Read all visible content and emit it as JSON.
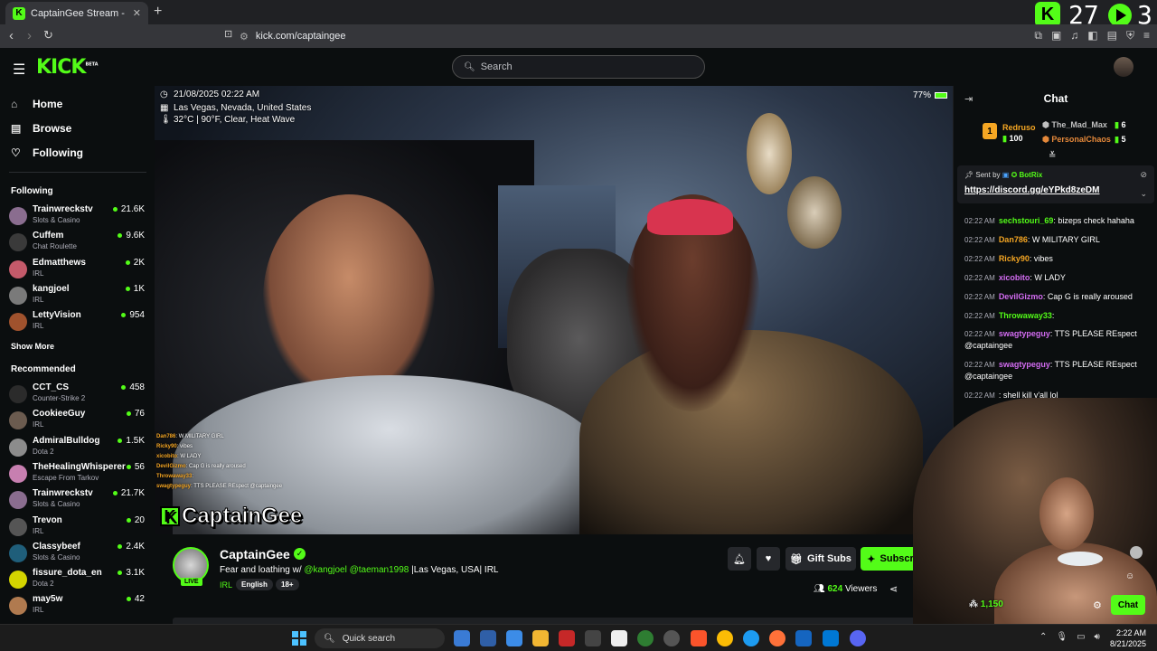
{
  "browser": {
    "tab_title": "CaptainGee Stream - Watch Liv",
    "tab_close": "✕",
    "new_tab": "+",
    "url": "kick.com/captaingee",
    "overlay_num1": "27",
    "overlay_num2": "3"
  },
  "header": {
    "logo": "KICK",
    "logo_badge": "BETA",
    "search_placeholder": "Search"
  },
  "sidebar": {
    "nav": [
      {
        "label": "Home",
        "icon": "home-icon"
      },
      {
        "label": "Browse",
        "icon": "browse-icon"
      },
      {
        "label": "Following",
        "icon": "heart-icon"
      }
    ],
    "following_title": "Following",
    "following": [
      {
        "name": "Trainwreckstv",
        "category": "Slots & Casino",
        "viewers": "21.6K",
        "color": "#8a6d8f"
      },
      {
        "name": "Cuffem",
        "category": "Chat Roulette",
        "viewers": "9.6K",
        "color": "#3a3a3a"
      },
      {
        "name": "Edmatthews",
        "category": "IRL",
        "viewers": "2K",
        "color": "#c45a6a"
      },
      {
        "name": "kangjoel",
        "category": "IRL",
        "viewers": "1K",
        "color": "#7a7a7a"
      },
      {
        "name": "LettyVision",
        "category": "IRL",
        "viewers": "954",
        "color": "#a0522d"
      }
    ],
    "show_more": "Show More",
    "recommended_title": "Recommended",
    "recommended": [
      {
        "name": "CCT_CS",
        "category": "Counter-Strike 2",
        "viewers": "458",
        "color": "#2b2b2b"
      },
      {
        "name": "CookieeGuy",
        "category": "IRL",
        "viewers": "76",
        "color": "#6b5b4f"
      },
      {
        "name": "AdmiralBulldog",
        "category": "Dota 2",
        "viewers": "1.5K",
        "color": "#8c8c8c"
      },
      {
        "name": "TheHealingWhisperer",
        "category": "Escape From Tarkov",
        "viewers": "56",
        "color": "#c77fb0"
      },
      {
        "name": "Trainwreckstv",
        "category": "Slots & Casino",
        "viewers": "21.7K",
        "color": "#8a6d8f"
      },
      {
        "name": "Trevon",
        "category": "IRL",
        "viewers": "20",
        "color": "#555"
      },
      {
        "name": "Classybeef",
        "category": "Slots & Casino",
        "viewers": "2.4K",
        "color": "#1f5e7a"
      },
      {
        "name": "fissure_dota_en",
        "category": "Dota 2",
        "viewers": "3.1K",
        "color": "#d4d400"
      },
      {
        "name": "may5w",
        "category": "IRL",
        "viewers": "42",
        "color": "#b07a4f"
      }
    ]
  },
  "video": {
    "datetime": "21/08/2025 02:22 AM",
    "location": "Las Vegas, Nevada, United States",
    "weather": "32°C | 90°F, Clear, Heat Wave",
    "battery": "77%",
    "mini_chat": [
      {
        "user": "Dan786",
        "text": ": W MILITARY GIRL"
      },
      {
        "user": "Ricky90",
        "text": ": vibes"
      },
      {
        "user": "xicobito",
        "text": ": W LADY"
      },
      {
        "user": "DevilGizmo",
        "text": ": Cap G is really aroused"
      },
      {
        "user": "Throwaway33",
        "text": ":"
      },
      {
        "user": "swagtypeguy",
        "text": ": TTS PLEASE REspect @captaingee"
      }
    ],
    "watermark": "CaptainGee"
  },
  "stream_info": {
    "channel": "CaptainGee",
    "live": "LIVE",
    "title_prefix": "Fear and loathing w/ ",
    "mention1": "@kangjoel",
    "mention2": "@taeman1998",
    "title_suffix": " |Las Vegas, USA| IRL",
    "category": "IRL",
    "tags": [
      "English",
      "18+"
    ],
    "gift_label": "Gift Subs",
    "subscribe_label": "Subscribe",
    "viewers_count": "624",
    "viewers_label": " Viewers"
  },
  "chat": {
    "title": "Chat",
    "leaderboard": [
      {
        "name": "Redruso",
        "count": "100",
        "rank": "1",
        "color": "#f5a623"
      },
      {
        "name": "The_Mad_Max",
        "count": "6",
        "color": "#c0c0c0"
      },
      {
        "name": "PersonalChaos",
        "count": "5",
        "color": "#e4883a"
      }
    ],
    "pinned": {
      "sent_by": "Sent by",
      "bot": "BotRix",
      "link": "https://discord.gg/eYPkd8zeDM"
    },
    "messages": [
      {
        "ts": "02:22 AM",
        "user": "sechstouri_69",
        "color": "#53fc18",
        "text": ": bizeps check hahaha"
      },
      {
        "ts": "02:22 AM",
        "user": "Dan786",
        "color": "#f5a623",
        "text": ": W MILITARY GIRL"
      },
      {
        "ts": "02:22 AM",
        "user": "Ricky90",
        "color": "#f5a623",
        "text": ": vibes"
      },
      {
        "ts": "02:22 AM",
        "user": "xicobito",
        "color": "#d36cf2",
        "text": ": W LADY"
      },
      {
        "ts": "02:22 AM",
        "user": "DevilGizmo",
        "color": "#d36cf2",
        "text": ": Cap G is really aroused"
      },
      {
        "ts": "02:22 AM",
        "user": "Throwaway33",
        "color": "#53fc18",
        "text": ":"
      },
      {
        "ts": "02:22 AM",
        "user": "swagtypeguy",
        "color": "#d36cf2",
        "text": ": TTS PLEASE REspect @captaingee"
      },
      {
        "ts": "02:22 AM",
        "user": "swagtypeguy",
        "color": "#d36cf2",
        "text": ": TTS PLEASE REspect @captaingee"
      },
      {
        "ts": "02:22 AM",
        "user": "",
        "color": "#f25c5c",
        "text": ": shell kill y'all lol"
      }
    ],
    "chatters": "1,150",
    "chat_button": "Chat"
  },
  "taskbar": {
    "search": "Quick search",
    "time": "2:22 AM",
    "date": "8/21/2025"
  }
}
